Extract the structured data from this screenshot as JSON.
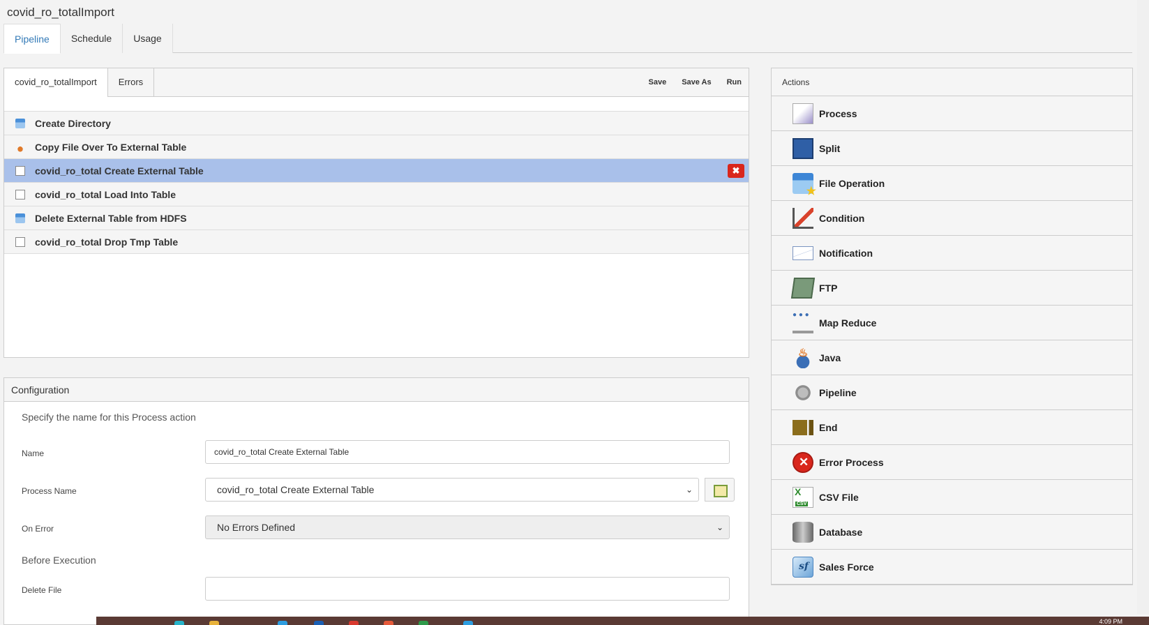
{
  "page_title": "covid_ro_totalImport",
  "top_tabs": [
    "Pipeline",
    "Schedule",
    "Usage"
  ],
  "pipeline": {
    "tabs": [
      "covid_ro_totalImport",
      "Errors"
    ],
    "actions": {
      "save": "Save",
      "save_as": "Save As",
      "run": "Run"
    },
    "steps": [
      {
        "label": "Create Directory",
        "icon": "folder-icon"
      },
      {
        "label": "Copy File Over To External Table",
        "icon": "java-icon"
      },
      {
        "label": "covid_ro_total Create External Table",
        "icon": "process-icon",
        "selected": true
      },
      {
        "label": "covid_ro_total Load Into Table",
        "icon": "process-icon"
      },
      {
        "label": "Delete External Table from HDFS",
        "icon": "folder-icon"
      },
      {
        "label": "covid_ro_total Drop Tmp Table",
        "icon": "process-icon"
      }
    ],
    "delete_symbol": "✖"
  },
  "configuration": {
    "header": "Configuration",
    "note": "Specify the name for this Process action",
    "name_label": "Name",
    "name_value": "covid_ro_total Create External Table",
    "process_name_label": "Process Name",
    "process_name_value": "covid_ro_total Create External Table",
    "on_error_label": "On Error",
    "on_error_value": "No Errors Defined",
    "before_execution": "Before Execution",
    "delete_file_label": "Delete File",
    "delete_file_value": ""
  },
  "actions_panel": {
    "header": "Actions",
    "items": [
      {
        "label": "Process",
        "icon": "process-icon"
      },
      {
        "label": "Split",
        "icon": "split-icon"
      },
      {
        "label": "File Operation",
        "icon": "file-operation-icon"
      },
      {
        "label": "Condition",
        "icon": "condition-icon"
      },
      {
        "label": "Notification",
        "icon": "envelope-icon"
      },
      {
        "label": "FTP",
        "icon": "ftp-icon"
      },
      {
        "label": "Map Reduce",
        "icon": "map-reduce-icon"
      },
      {
        "label": "Java",
        "icon": "java-icon"
      },
      {
        "label": "Pipeline",
        "icon": "gear-icon"
      },
      {
        "label": "End",
        "icon": "end-icon"
      },
      {
        "label": "Error Process",
        "icon": "error-icon"
      },
      {
        "label": "CSV File",
        "icon": "csv-file-icon"
      },
      {
        "label": "Database",
        "icon": "database-icon"
      },
      {
        "label": "Sales Force",
        "icon": "salesforce-icon"
      }
    ]
  },
  "taskbar": {
    "clock": "4:09 PM"
  },
  "colors": {
    "selected_row": "#a9c0ea",
    "delete_button": "#d9261c",
    "active_tab_text": "#337ab7"
  }
}
